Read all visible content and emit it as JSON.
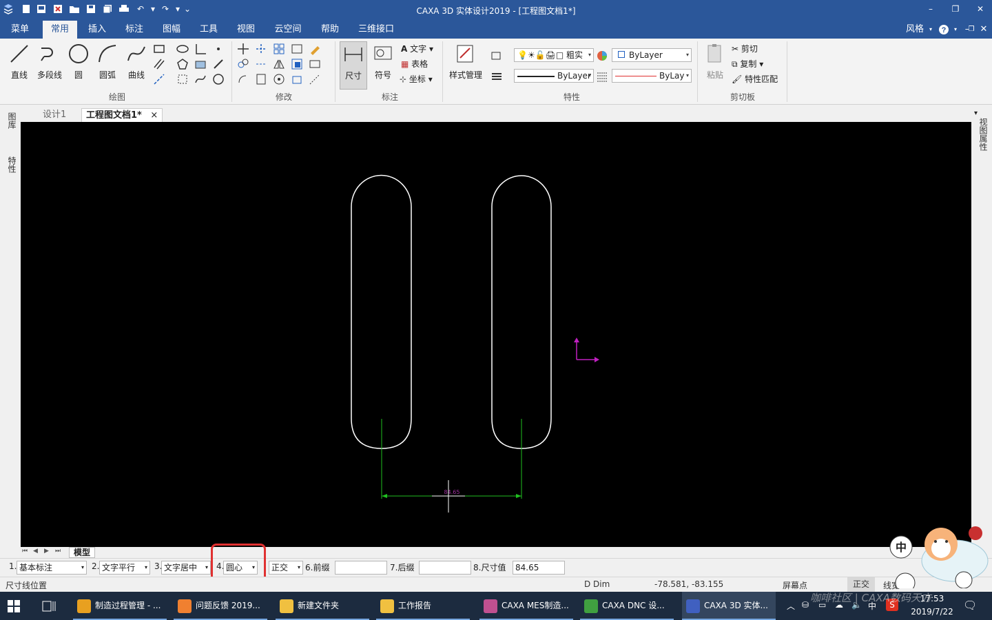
{
  "window": {
    "title": "CAXA 3D 实体设计2019 - [工程图文档1*]"
  },
  "menu": {
    "tabs": [
      "菜单",
      "常用",
      "插入",
      "标注",
      "图幅",
      "工具",
      "视图",
      "云空间",
      "帮助",
      "三维接口"
    ],
    "active": "常用",
    "style_label": "风格"
  },
  "ribbon": {
    "draw": {
      "line": "直线",
      "polyline": "多段线",
      "circle": "圆",
      "arc": "圆弧",
      "curve": "曲线",
      "group": "绘图"
    },
    "modify": {
      "group": "修改"
    },
    "annot": {
      "dimension": "尺寸",
      "symbol": "符号",
      "text": "文字",
      "table": "表格",
      "coord": "坐标",
      "group": "标注"
    },
    "props": {
      "style_manage": "样式管理",
      "linewidth": "粗实",
      "bylayer1": "ByLayer",
      "bylayer2": "ByLayer",
      "bylayer3": "ByLay",
      "group": "特性"
    },
    "clipboard": {
      "paste": "粘贴",
      "cut": "剪切",
      "copy": "复制",
      "match": "特性匹配",
      "group": "剪切板"
    }
  },
  "doctabs": {
    "tab1": "设计1",
    "tab2": "工程图文档1*",
    "close": "×"
  },
  "side": {
    "left1": "图库",
    "left2": "特性",
    "right1": "视图属性"
  },
  "canvas": {
    "dim_text": "84.65"
  },
  "model": {
    "tab": "模型"
  },
  "dimbar": {
    "p1_num": "1.",
    "p1": "基本标注",
    "p2_num": "2.",
    "p2": "文字平行",
    "p3_num": "3.",
    "p3": "文字居中",
    "p4_num": "4.",
    "p4": "圆心",
    "p5": "正交",
    "p6": "6.前缀",
    "p6_val": "",
    "p7": "7.后缀",
    "p7_val": "",
    "p8": "8.尺寸值",
    "p8_val": "84.65"
  },
  "status": {
    "prompt": "尺寸线位置",
    "cmd": "D Dim",
    "coords": "-78.581, -83.155",
    "snap": "屏幕点",
    "ortho": "正交",
    "linewidth": "线宽"
  },
  "taskbar": {
    "apps": [
      {
        "label": "制造过程管理 - ...",
        "color": "#e8a020"
      },
      {
        "label": "问题反馈 2019...",
        "color": "#f08030"
      },
      {
        "label": "新建文件夹",
        "color": "#f0c040"
      },
      {
        "label": "工作报告",
        "color": "#f0c040"
      },
      {
        "label": "CAXA MES制造...",
        "color": "#c05090"
      },
      {
        "label": "CAXA DNC 设...",
        "color": "#40a040"
      },
      {
        "label": "CAXA 3D 实体...",
        "color": "#4060c0"
      }
    ],
    "ime": "中",
    "time": "17:53",
    "date": "2019/7/22",
    "watermark": "咖啡社区 | CAXA数码天方"
  },
  "colors": {
    "brand": "#2b579a",
    "highlight": "#e03030",
    "geometry": "#ffffff",
    "dimension": "#20c020",
    "axis": "#c020c0"
  }
}
